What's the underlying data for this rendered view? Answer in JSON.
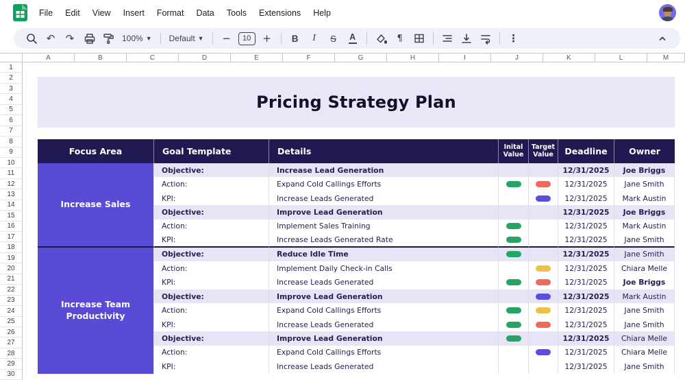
{
  "menubar": {
    "items": [
      "File",
      "Edit",
      "View",
      "Insert",
      "Format",
      "Data",
      "Tools",
      "Extensions",
      "Help"
    ]
  },
  "toolbar": {
    "zoom_value": "100%",
    "font_name": "Default",
    "font_size": "10",
    "glyphs": {
      "undo": "↶",
      "redo": "↷",
      "dropdown": "▾",
      "minus": "−",
      "plus": "+",
      "bold": "B",
      "italic": "I",
      "strikethrough": "S",
      "text_color": "A",
      "paragraph": "¶",
      "more": "⋮"
    }
  },
  "grid": {
    "column_letters": [
      "A",
      "B",
      "C",
      "D",
      "E",
      "F",
      "G",
      "H",
      "I",
      "J",
      "K",
      "L",
      "M"
    ],
    "row_numbers": [
      "1",
      "2",
      "3",
      "4",
      "5",
      "6",
      "7",
      "8",
      "9",
      "10",
      "11",
      "12",
      "13",
      "14",
      "15",
      "16",
      "17",
      "18",
      "19",
      "20",
      "21",
      "22",
      "23",
      "24",
      "25",
      "26",
      "27",
      "28",
      "29",
      "30"
    ]
  },
  "sheet": {
    "title": "Pricing Strategy Plan",
    "colors": {
      "header_bg": "#211a52",
      "focus_bg": "#5a4bd7",
      "objective_row_bg": "#e7e4f6",
      "banner_bg": "#e9e6f8",
      "text": "#232053"
    },
    "pill_colors": {
      "green": "#22a565",
      "red": "#ed6a5e",
      "yellow": "#eec04b",
      "blue": "#5b4ce4"
    },
    "table": {
      "headers": {
        "focus": "Focus Area",
        "goal": "Goal Template",
        "details": "Details",
        "inital": "Inital Value",
        "target": "Target Value",
        "deadline": "Deadline",
        "owner": "Owner"
      },
      "groups": [
        {
          "focus": "Increase Sales",
          "rows": [
            {
              "type": "objective",
              "label": "Objective:",
              "details": "Increase Lead Generation",
              "inital": null,
              "target": null,
              "deadline": "12/31/2025",
              "owner": "Joe Briggs",
              "owner_bold": true
            },
            {
              "type": "action",
              "label": "Action:",
              "details": "Expand Cold Callings Efforts",
              "inital": "green",
              "target": "red",
              "deadline": "12/31/2025",
              "owner": "Jane Smith",
              "owner_bold": false
            },
            {
              "type": "kpi",
              "label": "KPI:",
              "details": "Increase Leads Generated",
              "inital": null,
              "target": "blue",
              "deadline": "12/31/2025",
              "owner": "Mark Austin",
              "owner_bold": false
            },
            {
              "type": "objective",
              "label": "Objective:",
              "details": "Improve Lead Generation",
              "inital": null,
              "target": null,
              "deadline": "12/31/2025",
              "owner": "Joe Briggs",
              "owner_bold": true
            },
            {
              "type": "action",
              "label": "Action:",
              "details": "Implement Sales Training",
              "inital": "green",
              "target": null,
              "deadline": "12/31/2025",
              "owner": "Mark Austin",
              "owner_bold": false
            },
            {
              "type": "kpi",
              "label": "KPI:",
              "details": "Increase Leads Generated Rate",
              "inital": "green",
              "target": null,
              "deadline": "12/31/2025",
              "owner": "Jane Smith",
              "owner_bold": false
            }
          ]
        },
        {
          "focus": "Increase Team Productivity",
          "rows": [
            {
              "type": "objective",
              "label": "Objective:",
              "details": "Reduce Idle Time",
              "inital": "green",
              "target": null,
              "deadline": "12/31/2025",
              "owner": "Jane Smith",
              "owner_bold": false
            },
            {
              "type": "action",
              "label": "Action:",
              "details": "Implement Daily Check-in Calls",
              "inital": null,
              "target": "yellow",
              "deadline": "12/31/2025",
              "owner": "Chiara Melle",
              "owner_bold": false
            },
            {
              "type": "kpi",
              "label": "KPI:",
              "details": "Increase Leads Generated",
              "inital": "green",
              "target": "red",
              "deadline": "12/31/2025",
              "owner": "Joe Briggs",
              "owner_bold": true
            },
            {
              "type": "objective",
              "label": "Objective:",
              "details": "Improve Lead Generation",
              "inital": null,
              "target": "blue",
              "deadline": "12/31/2025",
              "owner": "Mark Austin",
              "owner_bold": false
            },
            {
              "type": "action",
              "label": "Action:",
              "details": "Expand Cold Callings Efforts",
              "inital": "green",
              "target": "yellow",
              "deadline": "12/31/2025",
              "owner": "Jane Smith",
              "owner_bold": false
            },
            {
              "type": "kpi",
              "label": "KPI:",
              "details": "Increase Leads Generated",
              "inital": "green",
              "target": "red",
              "deadline": "12/31/2025",
              "owner": "Jane Smith",
              "owner_bold": false
            },
            {
              "type": "objective",
              "label": "Objective:",
              "details": "Improve Lead Generation",
              "inital": "green",
              "target": null,
              "deadline": "12/31/2025",
              "owner": "Chiara Melle",
              "owner_bold": false
            },
            {
              "type": "action",
              "label": "Action:",
              "details": "Expand Cold Callings Efforts",
              "inital": null,
              "target": "blue",
              "deadline": "12/31/2025",
              "owner": "Chiara Melle",
              "owner_bold": false
            },
            {
              "type": "kpi",
              "label": "KPI:",
              "details": "Increase Leads Generated",
              "inital": null,
              "target": null,
              "deadline": "12/31/2025",
              "owner": "Jane Smith",
              "owner_bold": false
            }
          ]
        }
      ]
    }
  }
}
